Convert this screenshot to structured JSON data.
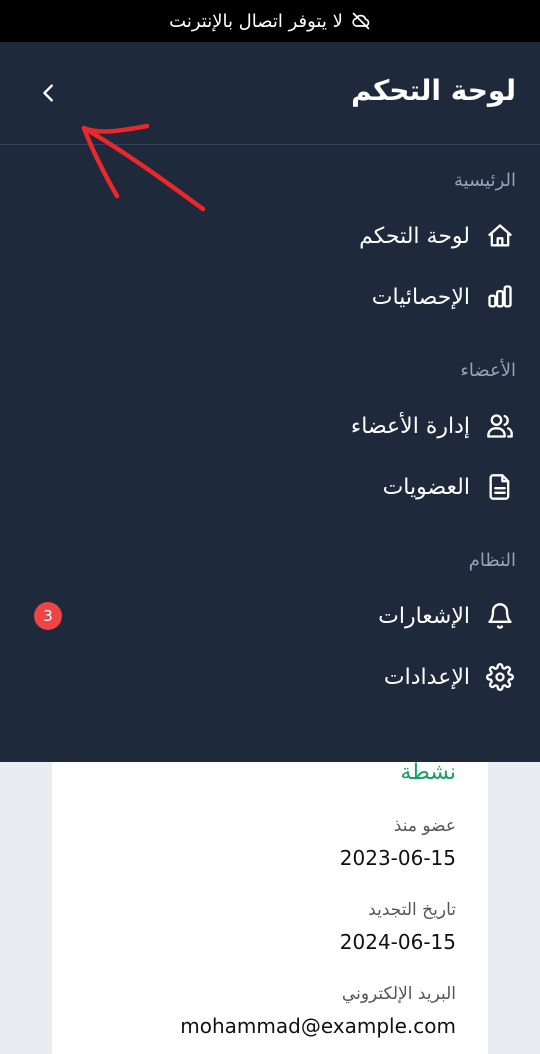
{
  "status_bar": {
    "message": "لا يتوفر اتصال بالإنترنت",
    "icon": "cloud-off-icon"
  },
  "drawer": {
    "title": "لوحة التحكم",
    "collapse_icon": "chevron-left-icon",
    "sections": [
      {
        "label": "الرئيسية",
        "items": [
          {
            "label": "لوحة التحكم",
            "icon": "home-icon"
          },
          {
            "label": "الإحصائيات",
            "icon": "bar-chart-icon"
          }
        ]
      },
      {
        "label": "الأعضاء",
        "items": [
          {
            "label": "إدارة الأعضاء",
            "icon": "users-icon"
          },
          {
            "label": "العضويات",
            "icon": "document-icon"
          }
        ]
      },
      {
        "label": "النظام",
        "items": [
          {
            "label": "الإشعارات",
            "icon": "bell-icon",
            "badge": "3"
          },
          {
            "label": "الإعدادات",
            "icon": "gear-icon"
          }
        ]
      }
    ]
  },
  "card": {
    "status": "نشطة",
    "fields": [
      {
        "label": "عضو منذ",
        "value": "2023-06-15"
      },
      {
        "label": "تاريخ التجديد",
        "value": "2024-06-15"
      },
      {
        "label": "البريد الإلكتروني",
        "value": "mohammad@example.com"
      }
    ]
  },
  "colors": {
    "drawer_bg": "#1e293b",
    "status_active": "#1aa260",
    "badge": "#ef4444",
    "annotation_arrow": "#e8282b"
  }
}
